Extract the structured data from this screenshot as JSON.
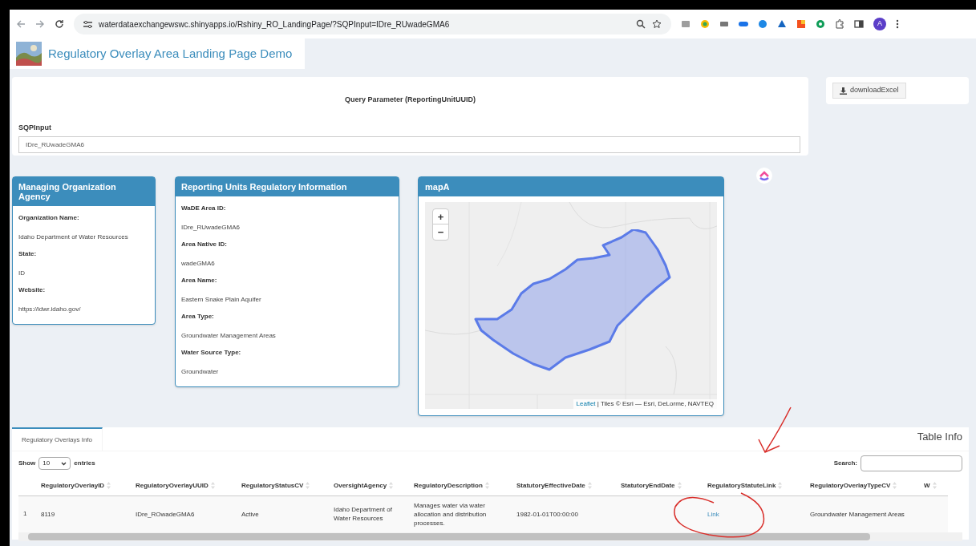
{
  "browser": {
    "url": "waterdataexchangewswc.shinyapps.io/Rshiny_RO_LandingPage/?SQPInput=IDre_RUwadeGMA6",
    "avatar": "A"
  },
  "app": {
    "title": "Regulatory Overlay Area Landing Page Demo"
  },
  "query": {
    "heading": "Query Parameter (ReportingUnitUUID)",
    "label": "SQPInput",
    "value": "IDre_RUwadeGMA6"
  },
  "download_button": "downloadExcel",
  "panels": [
    {
      "title": "Managing Organization Agency",
      "fields": [
        {
          "label": "Organization Name:",
          "value": "Idaho Department of Water Resources"
        },
        {
          "label": "State:",
          "value": "ID"
        },
        {
          "label": "Website:",
          "value": "https://idwr.idaho.gov/"
        }
      ]
    },
    {
      "title": "Reporting Units Regulatory Information",
      "fields": [
        {
          "label": "WaDE Area ID:",
          "value": "IDre_RUwadeGMA6"
        },
        {
          "label": "Area Native ID:",
          "value": "wadeGMA6"
        },
        {
          "label": "Area Name:",
          "value": "Eastern Snake Plain Aquifer"
        },
        {
          "label": "Area Type:",
          "value": "Groundwater Management Areas"
        },
        {
          "label": "Water Source Type:",
          "value": "Groundwater"
        }
      ]
    }
  ],
  "map": {
    "title": "mapA",
    "zoom_in": "+",
    "zoom_out": "−",
    "attribution_link": "Leaflet",
    "attribution": "| Tiles © Esri — Esri, DeLorme, NAVTEQ"
  },
  "tabs": [
    {
      "label": "Regulatory Overlays Info",
      "selected": true
    }
  ],
  "table_title": "Table Info",
  "table": {
    "show_label": "Show",
    "page_size": "10",
    "entries_label": "entries",
    "search_label": "Search:",
    "columns": [
      {
        "label": "RegulatoryOverlayID"
      },
      {
        "label": "RegulatoryOverlayUUID"
      },
      {
        "label": "RegulatoryStatusCV"
      },
      {
        "label": "OversightAgency"
      },
      {
        "label": "RegulatoryDescription"
      },
      {
        "label": "StatutoryEffectiveDate"
      },
      {
        "label": "StatutoryEndDate"
      },
      {
        "label": "RegulatoryStatuteLink"
      },
      {
        "label": "RegulatoryOverlayTypeCV"
      },
      {
        "label": "W"
      }
    ],
    "rows": [
      {
        "index": "1",
        "cells": [
          {
            "kind": "text",
            "text": "8119"
          },
          {
            "kind": "text",
            "text": "IDre_ROwadeGMA6"
          },
          {
            "kind": "text",
            "text": "Active"
          },
          {
            "kind": "text",
            "text": "Idaho Department of Water Resources"
          },
          {
            "kind": "text",
            "text": "Manages water via water allocation and distribution processes."
          },
          {
            "kind": "text",
            "text": "1982-01-01T00:00:00"
          },
          {
            "kind": "empty"
          },
          {
            "kind": "link",
            "text": "Link"
          },
          {
            "kind": "text",
            "text": "Groundwater Management Areas"
          },
          {
            "kind": "empty"
          }
        ]
      }
    ]
  }
}
